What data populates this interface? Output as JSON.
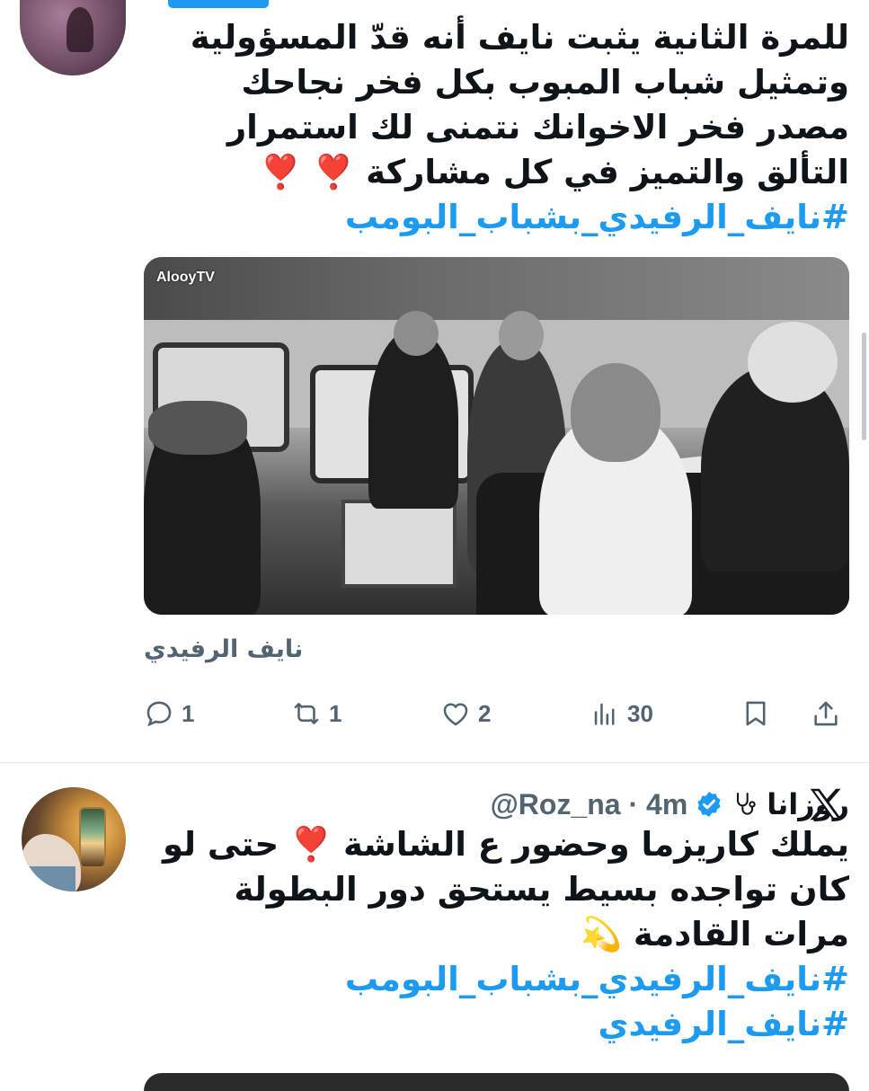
{
  "tweet1": {
    "text": "للمرة الثانية يثبت نايف أنه قدّ المسؤولية وتمثيل شباب المبوب بكل فخر نجاحك مصدر فخر الاخوانك نتمنى لك استمرار التألق والتميز في كل مشاركة",
    "emoji": "❣️ ❣️",
    "hashtag": "#نايف_الرفيدي_بشباب_البومب",
    "media_watermark": "AlooyTV",
    "media_caption": "نايف الرفيدي",
    "actions": {
      "reply_count": "1",
      "retweet_count": "1",
      "like_count": "2",
      "views_count": "30"
    }
  },
  "tweet2": {
    "display_name": "روزانا",
    "handle_time": "@Roz_na · 4m",
    "text": "يملك كاريزما وحضور ع الشاشة ❣️ حتى لو كان تواجده بسيط يستحق دور البطولة مرات القادمة 💫",
    "hashtags": [
      "#نايف_الرفيدي_بشباب_البومب",
      "#نايف_الرفيدي"
    ]
  },
  "colors": {
    "accent": "#1d9bf0",
    "text": "#0f1419",
    "muted": "#536471"
  },
  "icons": [
    "reply-icon",
    "retweet-icon",
    "like-icon",
    "views-icon",
    "bookmark-icon",
    "share-icon",
    "verified-icon",
    "stethoscope-icon",
    "x-logo-icon"
  ]
}
